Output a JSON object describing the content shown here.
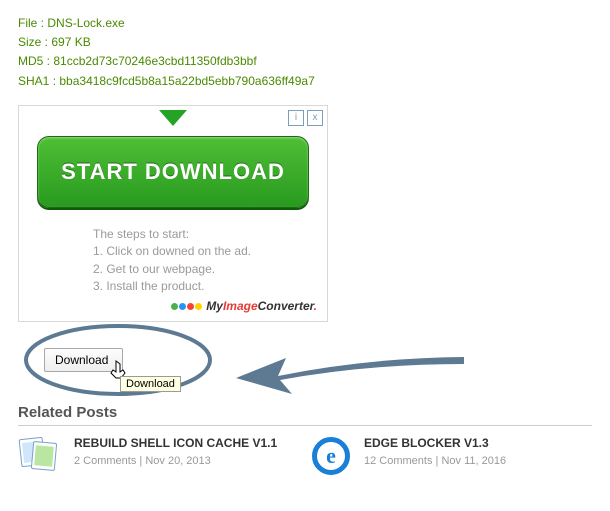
{
  "file_info": {
    "file_label": "File",
    "file_value": "DNS-Lock.exe",
    "size_label": "Size",
    "size_value": "697 KB",
    "md5_label": "MD5",
    "md5_value": "81ccb2d73c70246e3cbd11350fdb3bbf",
    "sha1_label": "SHA1",
    "sha1_value": "bba3418c9fcd5b8a15a22bd5ebb790a636ff49a7"
  },
  "ad": {
    "button_label": "START DOWNLOAD",
    "steps_title": "The steps to start:",
    "step1": "1. Click on downed on the ad.",
    "step2": "2. Get to our webpage.",
    "step3": "3. Install the product.",
    "brand_my": "My",
    "brand_image": "Image",
    "brand_conv": "Converter",
    "brand_dot": ".",
    "close_info": "i",
    "close_x": "x"
  },
  "download": {
    "button_label": "Download",
    "tooltip": "Download"
  },
  "related": {
    "heading": "Related Posts",
    "posts": [
      {
        "title": "REBUILD SHELL ICON CACHE V1.1",
        "comments": "2 Comments",
        "date": "Nov 20, 2013"
      },
      {
        "title": "EDGE BLOCKER V1.3",
        "comments": "12 Comments",
        "date": "Nov 11, 2016"
      }
    ],
    "sep": " | "
  }
}
